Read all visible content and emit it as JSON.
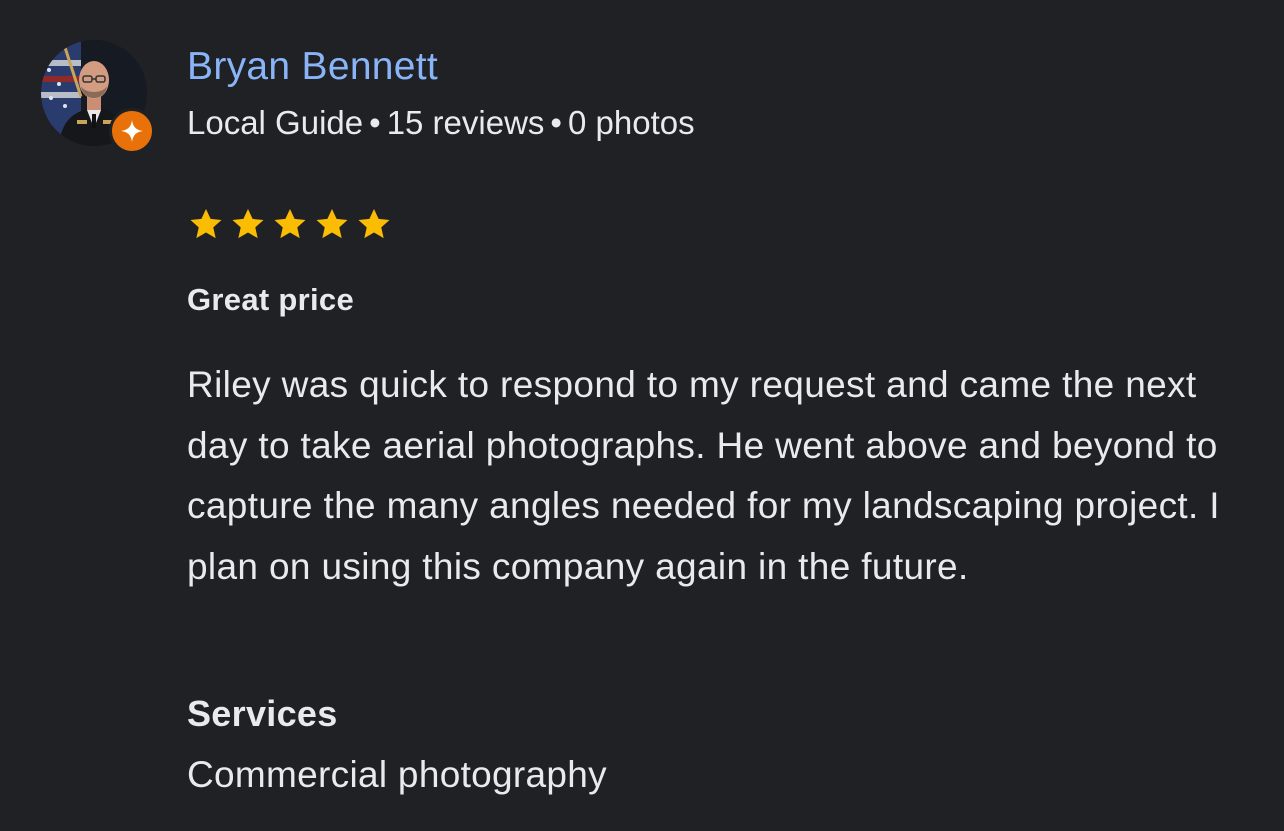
{
  "review": {
    "author": {
      "name": "Bryan Bennett",
      "role": "Local Guide",
      "reviews": "15 reviews",
      "photos": "0 photos",
      "separator": "•",
      "avatar_icon": "profile-photo",
      "badge_icon": "local-guide-star-icon"
    },
    "rating": {
      "stars": 5,
      "max": 5,
      "star_color": "#fbbc04"
    },
    "title": "Great price",
    "body": "Riley was quick to respond to my request and came the next day to take aerial photographs. He went above and beyond to capture the many angles needed for my landscaping project. I plan on using this company again in the future.",
    "services": {
      "heading": "Services",
      "value": "Commercial photography"
    }
  },
  "colors": {
    "background": "#202124",
    "name_link": "#8ab4f8",
    "text": "#e8eaed",
    "badge": "#e8710a"
  }
}
